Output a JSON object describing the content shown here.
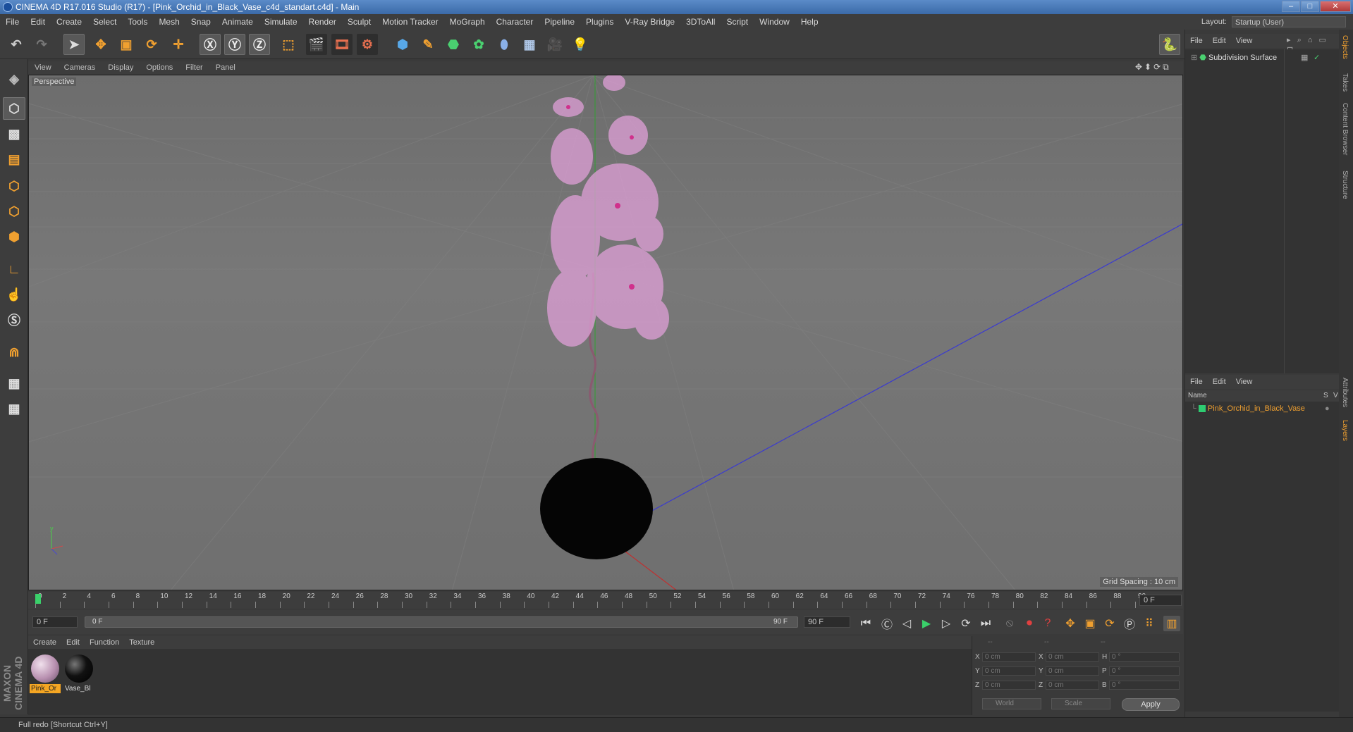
{
  "window": {
    "title": "CINEMA 4D R17.016 Studio (R17) - [Pink_Orchid_in_Black_Vase_c4d_standart.c4d] - Main"
  },
  "menu": [
    "File",
    "Edit",
    "Create",
    "Select",
    "Tools",
    "Mesh",
    "Snap",
    "Animate",
    "Simulate",
    "Render",
    "Sculpt",
    "Motion Tracker",
    "MoGraph",
    "Character",
    "Pipeline",
    "Plugins",
    "V-Ray Bridge",
    "3DToAll",
    "Script",
    "Window",
    "Help"
  ],
  "layout": {
    "label": "Layout:",
    "value": "Startup (User)"
  },
  "viewport": {
    "menu": [
      "View",
      "Cameras",
      "Display",
      "Options",
      "Filter",
      "Panel"
    ],
    "camera_label": "Perspective",
    "grid_spacing": "Grid Spacing : 10 cm"
  },
  "timeline": {
    "ticks": [
      "0",
      "2",
      "4",
      "6",
      "8",
      "10",
      "12",
      "14",
      "16",
      "18",
      "20",
      "22",
      "24",
      "26",
      "28",
      "30",
      "32",
      "34",
      "36",
      "38",
      "40",
      "42",
      "44",
      "46",
      "48",
      "50",
      "52",
      "54",
      "56",
      "58",
      "60",
      "62",
      "64",
      "66",
      "68",
      "70",
      "72",
      "74",
      "76",
      "78",
      "80",
      "82",
      "84",
      "86",
      "88",
      "90"
    ],
    "current_frame": "0 F",
    "start_field": "0 F",
    "range_start": "0 F",
    "range_end": "90 F",
    "end_field": "90 F"
  },
  "materials": {
    "menu": [
      "Create",
      "Edit",
      "Function",
      "Texture"
    ],
    "items": [
      {
        "label": "Pink_Or",
        "color": "#c8a0c0",
        "selected": true
      },
      {
        "label": "Vase_Bl",
        "color": "#0a0a0a",
        "selected": false
      }
    ]
  },
  "coordinates": {
    "header": [
      "--",
      "--",
      "--"
    ],
    "rows": [
      {
        "a": "X",
        "av": "0 cm",
        "b": "X",
        "bv": "0 cm",
        "c": "H",
        "cv": "0 °"
      },
      {
        "a": "Y",
        "av": "0 cm",
        "b": "Y",
        "bv": "0 cm",
        "c": "P",
        "cv": "0 °"
      },
      {
        "a": "Z",
        "av": "0 cm",
        "b": "Z",
        "bv": "0 cm",
        "c": "B",
        "cv": "0 °"
      }
    ],
    "mode1": "World",
    "mode2": "Scale",
    "apply": "Apply"
  },
  "objects_panel": {
    "menu": [
      "File",
      "Edit",
      "View"
    ],
    "items": [
      {
        "name": "Subdivision Surface"
      }
    ]
  },
  "layers_panel": {
    "menu": [
      "File",
      "Edit",
      "View"
    ],
    "col_name": "Name",
    "col_s": "S",
    "col_v": "V",
    "items": [
      {
        "name": "Pink_Orchid_in_Black_Vase",
        "color": "#2ecc71"
      }
    ]
  },
  "side_tabs": [
    "Objects",
    "Takes",
    "Content Browser",
    "Structure",
    "Attributes",
    "Layers"
  ],
  "status": "Full redo [Shortcut Ctrl+Y]",
  "brand": "MAXON CINEMA 4D",
  "colors": {
    "accent": "#f0a030",
    "selected_material": "#f5a623",
    "layer_text": "#f0a030"
  }
}
